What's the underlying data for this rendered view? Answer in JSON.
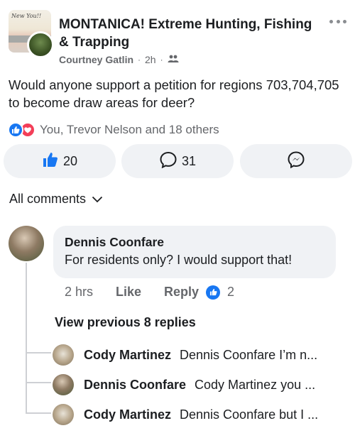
{
  "post": {
    "group_name": "MONTANICA! Extreme Hunting, Fishing & Trapping",
    "group_avatar_script": "New You!!",
    "author": "Courtney Gatlin",
    "time": "2h",
    "audience_icon": "group-icon",
    "text": "Would anyone support a petition for regions 703,704,705 to become draw areas for deer?",
    "reactions_summary": "You, Trevor Nelson and 18 others"
  },
  "actions": {
    "like_count": "20",
    "comment_count": "31"
  },
  "comments_filter": {
    "label": "All comments"
  },
  "comment": {
    "author": "Dennis Coonfare",
    "text": "For residents only? I would support that!",
    "time": "2 hrs",
    "like_label": "Like",
    "reply_label": "Reply",
    "like_count": "2"
  },
  "replies": {
    "view_previous_label": "View previous 8 replies",
    "items": [
      {
        "author": "Cody Martinez",
        "text": "Dennis Coonfare I’m n..."
      },
      {
        "author": "Dennis Coonfare",
        "text": "Cody Martinez  you ..."
      },
      {
        "author": "Cody Martinez",
        "text": "Dennis Coonfare but I ..."
      }
    ]
  },
  "colors": {
    "accent": "#1877f2",
    "love": "#f33e58",
    "muted_text": "#65676b",
    "button_bg": "#f0f2f5"
  }
}
